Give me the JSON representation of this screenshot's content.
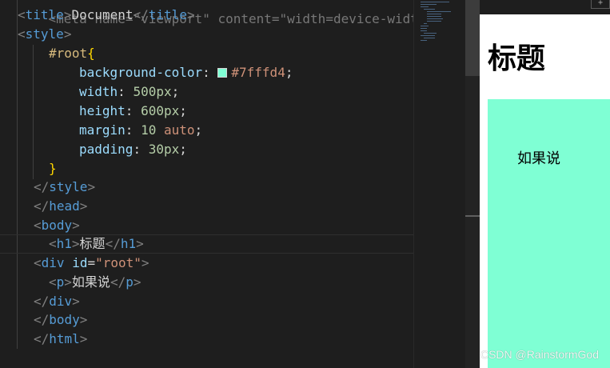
{
  "editor": {
    "top_partial": "<meta name=\"viewport\" content=\"width=device-width, i",
    "title_tag": "title",
    "title_text": "Document",
    "style_tag": "style",
    "selector": "#root",
    "props": [
      {
        "name": "background-color",
        "value": "#7fffd4",
        "swatch": "#7fffd4"
      },
      {
        "name": "width",
        "value": "500px"
      },
      {
        "name": "height",
        "value": "600px"
      },
      {
        "name": "margin",
        "num": "10",
        "kw": "auto"
      },
      {
        "name": "padding",
        "value": "30px"
      }
    ],
    "head_tag": "head",
    "body_tag": "body",
    "h1_tag": "h1",
    "h1_text": "标题",
    "div_tag": "div",
    "id_attr": "id",
    "id_value": "\"root\"",
    "p_tag": "p",
    "p_text": "如果说",
    "html_tag": "html"
  },
  "preview": {
    "heading": "标题",
    "paragraph": "如果说",
    "root_color": "#7fffd4",
    "top_button": "+"
  },
  "watermark": "CSDN @RainstormGod"
}
